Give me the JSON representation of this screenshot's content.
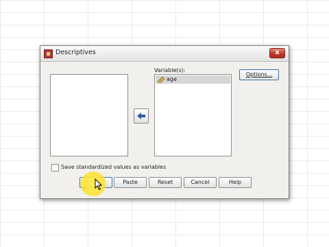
{
  "dialog": {
    "title": "Descriptives",
    "close_label": "x",
    "variables_label": "Variable(s):",
    "options_label": "Options...",
    "selected_variables": [
      {
        "name": "age",
        "icon": "ruler-icon"
      }
    ],
    "checkbox_label": "Save standardized values as variables",
    "checkbox_checked": false,
    "buttons": {
      "ok": "OK",
      "paste": "Paste",
      "reset": "Reset",
      "cancel": "Cancel",
      "help": "Help"
    }
  },
  "colors": {
    "dialog_bg": "#f1f0ec",
    "close_red": "#c0382a",
    "highlight_yellow": "#ffe650",
    "arrow_blue": "#2f5fa7"
  }
}
